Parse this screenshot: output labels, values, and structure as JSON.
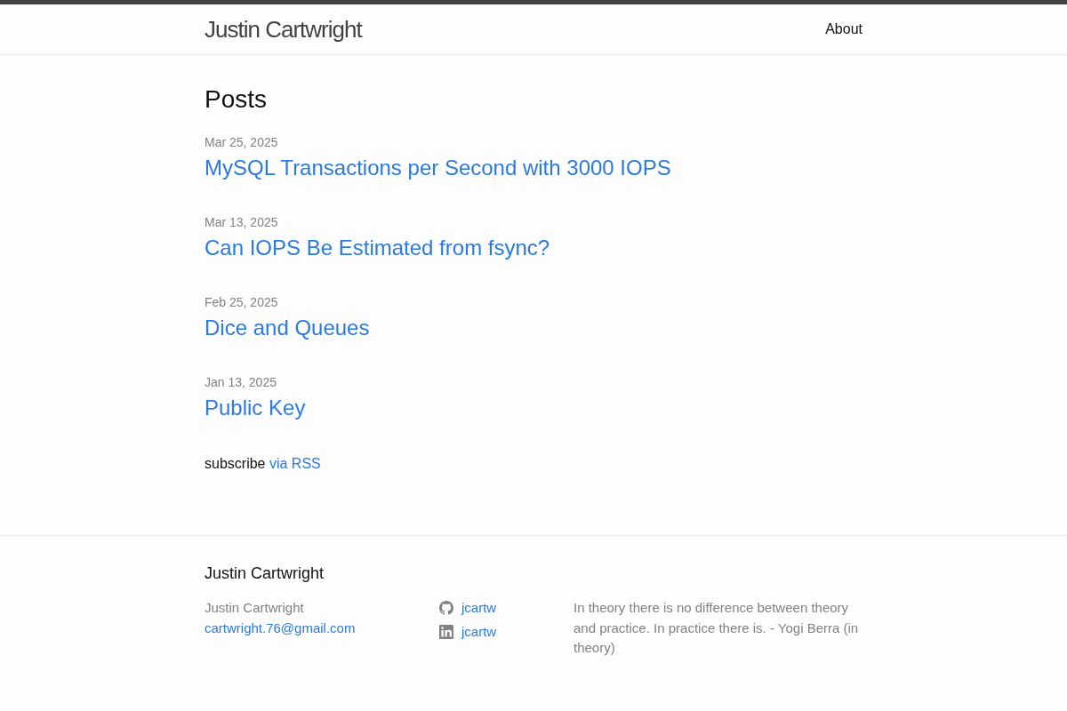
{
  "header": {
    "site_title": "Justin Cartwright",
    "nav": [
      {
        "label": "About"
      }
    ]
  },
  "posts_heading": "Posts",
  "posts": [
    {
      "date": "Mar 25, 2025",
      "title": "MySQL Transactions per Second with 3000 IOPS"
    },
    {
      "date": "Mar 13, 2025",
      "title": "Can IOPS Be Estimated from fsync?"
    },
    {
      "date": "Feb 25, 2025",
      "title": "Dice and Queues"
    },
    {
      "date": "Jan 13, 2025",
      "title": "Public Key"
    }
  ],
  "subscribe": {
    "text": "subscribe",
    "link": "via RSS"
  },
  "footer": {
    "heading": "Justin Cartwright",
    "name": "Justin Cartwright",
    "email": "cartwright.76@gmail.com",
    "social": [
      {
        "kind": "github",
        "label": "jcartw"
      },
      {
        "kind": "linkedin",
        "label": "jcartw"
      }
    ],
    "description": "In theory there is no difference between theory and practice. In practice there is. - Yogi Berra (in theory)"
  }
}
